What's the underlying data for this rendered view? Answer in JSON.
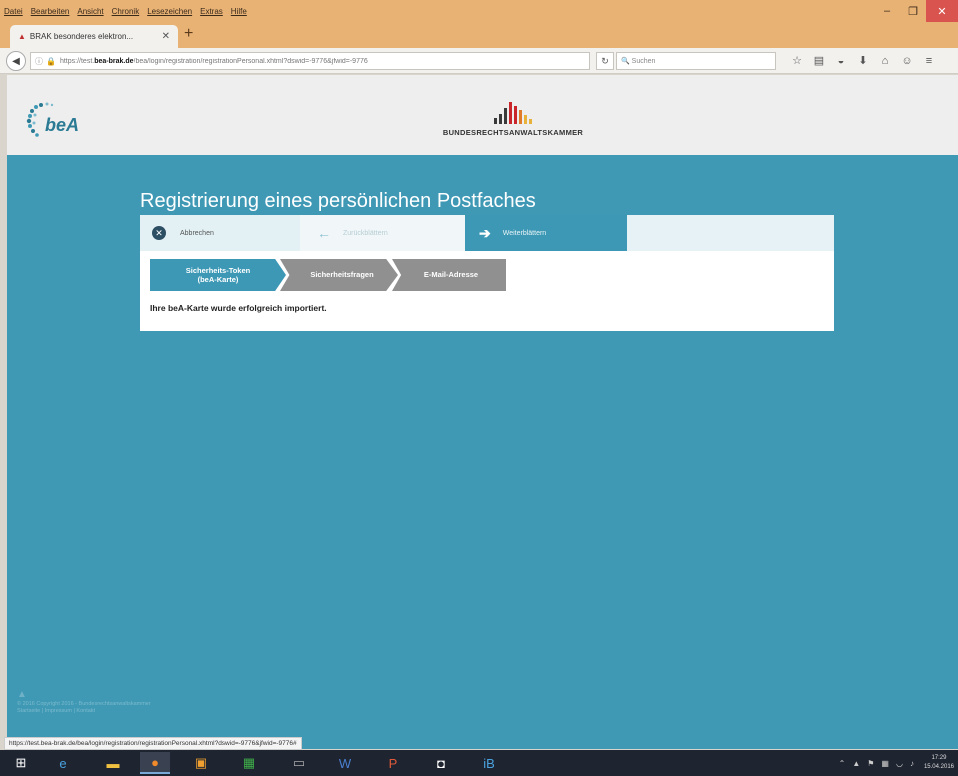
{
  "browser": {
    "menu": [
      "Datei",
      "Bearbeiten",
      "Ansicht",
      "Chronik",
      "Lesezeichen",
      "Extras",
      "Hilfe"
    ],
    "tab_title": "BRAK besonderes elektron...",
    "url_prefix": "https://test.",
    "url_host": "bea-brak.de",
    "url_path": "/bea/login/registration/registrationPersonal.xhtml?dswid=-9776&jfwid=-9776",
    "search_placeholder": "Suchen",
    "status_url": "https://test.bea-brak.de/bea/login/registration/registrationPersonal.xhtml?dswid=-9776&jfwid=-9776#"
  },
  "header": {
    "bea_logo_text": "beA",
    "brak_name": "BUNDESRECHTSANWALTSKAMMER"
  },
  "page": {
    "title": "Registrierung eines persönlichen Postfaches",
    "nav": {
      "cancel": "Abbrechen",
      "back": "Zurückblättern",
      "next": "Weiterblättern"
    },
    "steps": {
      "step1_line1": "Sicherheits-Token",
      "step1_line2": "(beA-Karte)",
      "step2": "Sicherheitsfragen",
      "step3": "E-Mail-Adresse"
    },
    "message": "Ihre beA-Karte wurde erfolgreich importiert."
  },
  "footer": {
    "copyright": "© 2016 Copyright 2016 - Bundesrechtsanwaltskammer",
    "links": "Startseite | Impressum | Kontakt"
  },
  "taskbar": {
    "clock_time": "17:29",
    "clock_date": "15.04.2016"
  },
  "colors": {
    "teal": "#3f99b5",
    "active_step": "#3c98b5",
    "inactive_step": "#909090",
    "menu_bar": "#e9b275"
  }
}
